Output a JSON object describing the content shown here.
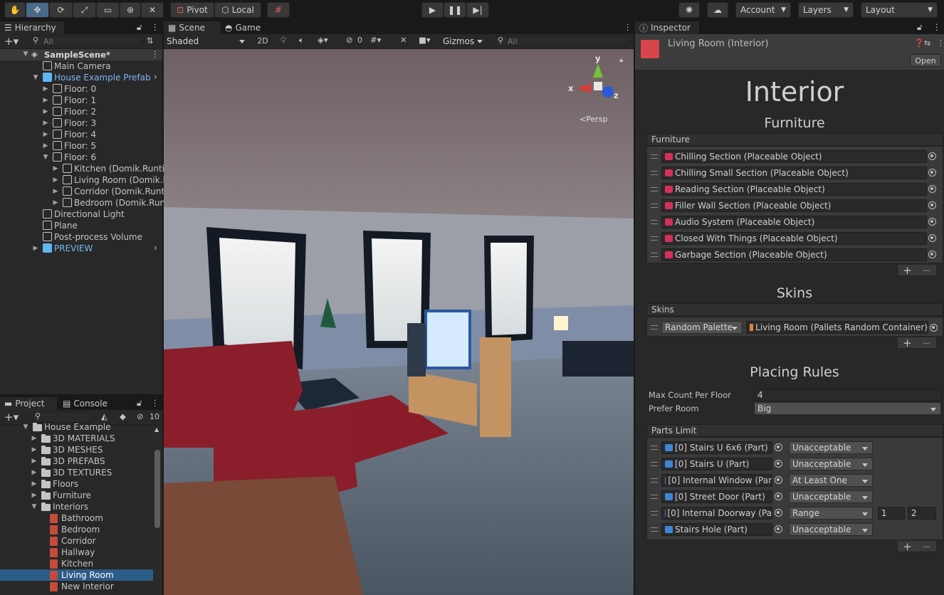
{
  "toolbar": {
    "pivot": "Pivot",
    "local": "Local",
    "account": "Account",
    "layers": "Layers",
    "layout": "Layout"
  },
  "hierarchy": {
    "tab": "Hierarchy",
    "search_placeholder": "All",
    "scene": "SampleScene*",
    "items": [
      {
        "label": "Main Camera"
      },
      {
        "label": "House Example Prefab"
      },
      {
        "label": "Floor: 0"
      },
      {
        "label": "Floor: 1"
      },
      {
        "label": "Floor: 2"
      },
      {
        "label": "Floor: 3"
      },
      {
        "label": "Floor: 4"
      },
      {
        "label": "Floor: 5"
      },
      {
        "label": "Floor: 6"
      },
      {
        "label": "Kitchen (Domik.Runtir"
      },
      {
        "label": "Living Room (Domik.R"
      },
      {
        "label": "Corridor (Domik.Runt"
      },
      {
        "label": "Bedroom (Domik.Run"
      },
      {
        "label": "Directional Light"
      },
      {
        "label": "Plane"
      },
      {
        "label": "Post-process Volume"
      },
      {
        "label": "PREVIEW"
      }
    ]
  },
  "project": {
    "tab": "Project",
    "console_tab": "Console",
    "hidden_count": "10",
    "items": [
      {
        "label": "House Example"
      },
      {
        "label": "3D MATERIALS"
      },
      {
        "label": "3D MESHES"
      },
      {
        "label": "3D PREFABS"
      },
      {
        "label": "3D TEXTURES"
      },
      {
        "label": "Floors"
      },
      {
        "label": "Furniture"
      },
      {
        "label": "Interiors"
      },
      {
        "label": "Bathroom"
      },
      {
        "label": "Bedroom"
      },
      {
        "label": "Corridor"
      },
      {
        "label": "Hallway"
      },
      {
        "label": "Kitchen"
      },
      {
        "label": "Living Room"
      },
      {
        "label": "New Interior"
      }
    ]
  },
  "scene_view": {
    "scene_tab": "Scene",
    "game_tab": "Game",
    "shading": "Shaded",
    "mode_2d": "2D",
    "hidden_count": "0",
    "gizmos": "Gizmos",
    "search_placeholder": "All",
    "axis_x": "x",
    "axis_y": "y",
    "axis_z": "z",
    "persp": "Persp"
  },
  "inspector": {
    "tab": "Inspector",
    "object_name": "Living Room (Interior)",
    "open_button": "Open",
    "big_title": "Interior",
    "furniture_heading": "Furniture",
    "furniture_list_header": "Furniture",
    "furniture_items": [
      "Chilling Section (Placeable Object)",
      "Chilling Small Section (Placeable Object)",
      "Reading Section (Placeable Object)",
      "Filler Wall Section (Placeable Object)",
      "Audio System (Placeable Object)",
      "Closed With Things (Placeable Object)",
      "Garbage Section (Placeable Object)"
    ],
    "skins_heading": "Skins",
    "skins_list_header": "Skins",
    "skin_mode": "Random Palette",
    "skin_value": "Living Room (Pallets Random Container)",
    "placing_heading": "Placing Rules",
    "max_count_label": "Max Count Per Floor",
    "max_count_value": "4",
    "prefer_room_label": "Prefer Room",
    "prefer_room_value": "Big",
    "parts_header": "Parts Limit",
    "parts": [
      {
        "part": "[0] Stairs U 6x6 (Part)",
        "rule": "Unacceptable"
      },
      {
        "part": "[0] Stairs U (Part)",
        "rule": "Unacceptable"
      },
      {
        "part": "[0] Internal Window (Par",
        "rule": "At Least One"
      },
      {
        "part": "[0] Street Door (Part)",
        "rule": "Unacceptable"
      },
      {
        "part": "[0] Internal Doorway (Pa",
        "rule": "Range",
        "min": "1",
        "max": "2"
      },
      {
        "part": "Stairs Hole (Part)",
        "rule": "Unacceptable"
      }
    ],
    "plus": "+",
    "minus": "−"
  }
}
